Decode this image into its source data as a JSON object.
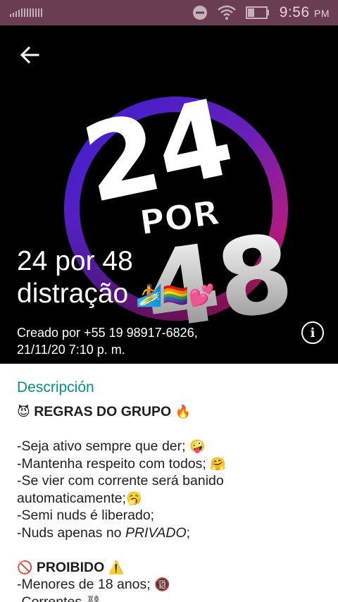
{
  "status_bar": {
    "time": "9:56",
    "ampm": "PM",
    "icons": [
      "signal-icon",
      "dnd-icon",
      "wifi-icon",
      "battery-icon"
    ]
  },
  "header": {
    "logo_text_top": "24",
    "logo_text_mid": "POR",
    "logo_text_bottom": "48",
    "title_line1": "24 por 48",
    "title_line2": "distração",
    "title_emojis": "🏄🏳️‍🌈💕",
    "created_line1": "Creado por +55 19 98917-6826,",
    "created_line2": "21/11/20 7:10 p. m."
  },
  "description": {
    "label": "Descripción",
    "rules_heading": "REGRAS DO GRUPO",
    "rules_heading_emoji_left": "😈",
    "rules_heading_emoji_right": "🔥",
    "rule1": "-Seja ativo sempre que der;",
    "rule1_emoji": "🤪",
    "rule2": "-Mantenha respeito com todos;",
    "rule2_emoji": "🤗",
    "rule3a": "-Se vier com corrente será banido",
    "rule3b": "automaticamente;",
    "rule3_emoji": "🥱",
    "rule4": "-Semi nuds é liberado;",
    "rule5_prefix": "-Nuds apenas no ",
    "rule5_italic": "PRIVADO",
    "rule5_suffix": ";",
    "prohibited_heading": "PROIBIDO",
    "prohibited_emoji_left": "🚫",
    "prohibited_emoji_right": "⚠️",
    "p1": "-Menores de 18 anos;",
    "p1_emoji": "🔞",
    "p2": "-Correntes",
    "p2_emoji": "⛓"
  }
}
